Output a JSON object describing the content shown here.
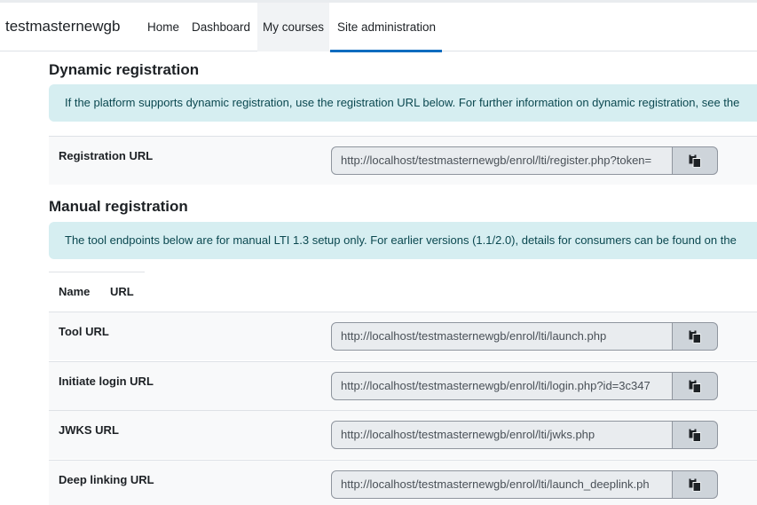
{
  "brand": "testmasternewgb",
  "nav": {
    "home": "Home",
    "dashboard": "Dashboard",
    "my_courses": "My courses",
    "site_admin": "Site administration"
  },
  "dynamic": {
    "heading": "Dynamic registration",
    "info": "If the platform supports dynamic registration, use the registration URL below. For further information on dynamic registration, see the",
    "registration_label": "Registration URL",
    "registration_value": "http://localhost/testmasternewgb/enrol/lti/register.php?token="
  },
  "manual": {
    "heading": "Manual registration",
    "info": "The tool endpoints below are for manual LTI 1.3 setup only. For earlier versions (1.1/2.0), details for consumers can be found on the",
    "col_name": "Name",
    "col_url": "URL",
    "rows": [
      {
        "label": "Tool URL",
        "value": "http://localhost/testmasternewgb/enrol/lti/launch.php"
      },
      {
        "label": "Initiate login URL",
        "value": "http://localhost/testmasternewgb/enrol/lti/login.php?id=3c347"
      },
      {
        "label": "JWKS URL",
        "value": "http://localhost/testmasternewgb/enrol/lti/jwks.php"
      },
      {
        "label": "Deep linking URL",
        "value": "http://localhost/testmasternewgb/enrol/lti/launch_deeplink.ph"
      }
    ]
  },
  "icons": {
    "copy": "copy-icon"
  },
  "colors": {
    "accent": "#0f6cbf",
    "alert_bg": "#d6eef1",
    "alert_text": "#0b4850"
  }
}
